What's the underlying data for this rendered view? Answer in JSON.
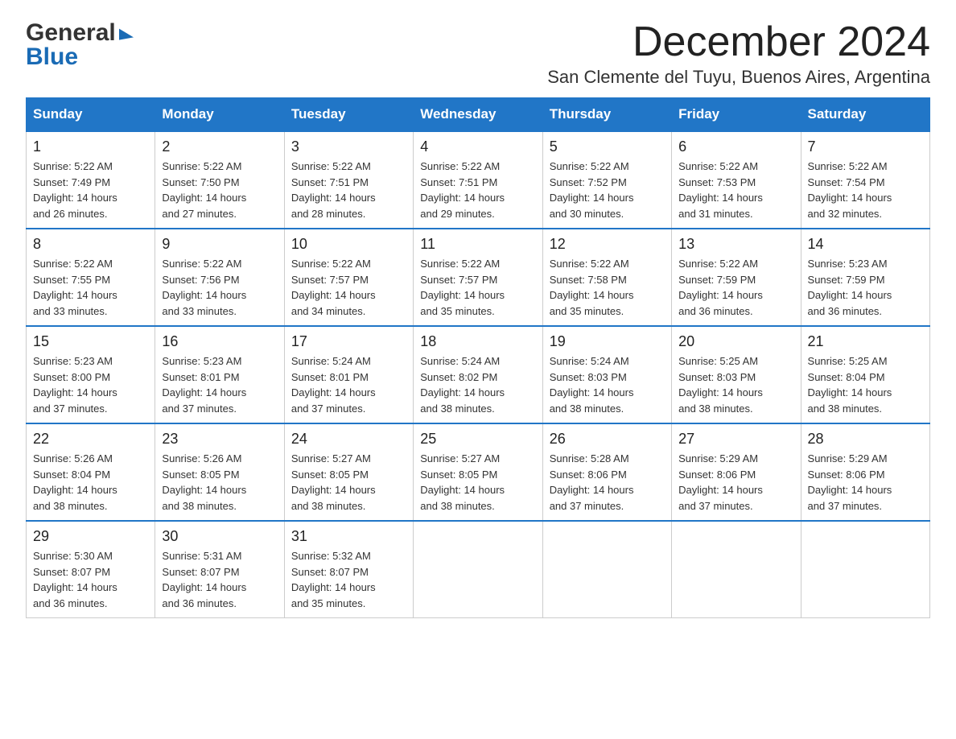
{
  "logo": {
    "line1": "General",
    "line2": "Blue"
  },
  "title": "December 2024",
  "subtitle": "San Clemente del Tuyu, Buenos Aires, Argentina",
  "days_of_week": [
    "Sunday",
    "Monday",
    "Tuesday",
    "Wednesday",
    "Thursday",
    "Friday",
    "Saturday"
  ],
  "weeks": [
    [
      {
        "day": "1",
        "sunrise": "5:22 AM",
        "sunset": "7:49 PM",
        "daylight": "14 hours and 26 minutes."
      },
      {
        "day": "2",
        "sunrise": "5:22 AM",
        "sunset": "7:50 PM",
        "daylight": "14 hours and 27 minutes."
      },
      {
        "day": "3",
        "sunrise": "5:22 AM",
        "sunset": "7:51 PM",
        "daylight": "14 hours and 28 minutes."
      },
      {
        "day": "4",
        "sunrise": "5:22 AM",
        "sunset": "7:51 PM",
        "daylight": "14 hours and 29 minutes."
      },
      {
        "day": "5",
        "sunrise": "5:22 AM",
        "sunset": "7:52 PM",
        "daylight": "14 hours and 30 minutes."
      },
      {
        "day": "6",
        "sunrise": "5:22 AM",
        "sunset": "7:53 PM",
        "daylight": "14 hours and 31 minutes."
      },
      {
        "day": "7",
        "sunrise": "5:22 AM",
        "sunset": "7:54 PM",
        "daylight": "14 hours and 32 minutes."
      }
    ],
    [
      {
        "day": "8",
        "sunrise": "5:22 AM",
        "sunset": "7:55 PM",
        "daylight": "14 hours and 33 minutes."
      },
      {
        "day": "9",
        "sunrise": "5:22 AM",
        "sunset": "7:56 PM",
        "daylight": "14 hours and 33 minutes."
      },
      {
        "day": "10",
        "sunrise": "5:22 AM",
        "sunset": "7:57 PM",
        "daylight": "14 hours and 34 minutes."
      },
      {
        "day": "11",
        "sunrise": "5:22 AM",
        "sunset": "7:57 PM",
        "daylight": "14 hours and 35 minutes."
      },
      {
        "day": "12",
        "sunrise": "5:22 AM",
        "sunset": "7:58 PM",
        "daylight": "14 hours and 35 minutes."
      },
      {
        "day": "13",
        "sunrise": "5:22 AM",
        "sunset": "7:59 PM",
        "daylight": "14 hours and 36 minutes."
      },
      {
        "day": "14",
        "sunrise": "5:23 AM",
        "sunset": "7:59 PM",
        "daylight": "14 hours and 36 minutes."
      }
    ],
    [
      {
        "day": "15",
        "sunrise": "5:23 AM",
        "sunset": "8:00 PM",
        "daylight": "14 hours and 37 minutes."
      },
      {
        "day": "16",
        "sunrise": "5:23 AM",
        "sunset": "8:01 PM",
        "daylight": "14 hours and 37 minutes."
      },
      {
        "day": "17",
        "sunrise": "5:24 AM",
        "sunset": "8:01 PM",
        "daylight": "14 hours and 37 minutes."
      },
      {
        "day": "18",
        "sunrise": "5:24 AM",
        "sunset": "8:02 PM",
        "daylight": "14 hours and 38 minutes."
      },
      {
        "day": "19",
        "sunrise": "5:24 AM",
        "sunset": "8:03 PM",
        "daylight": "14 hours and 38 minutes."
      },
      {
        "day": "20",
        "sunrise": "5:25 AM",
        "sunset": "8:03 PM",
        "daylight": "14 hours and 38 minutes."
      },
      {
        "day": "21",
        "sunrise": "5:25 AM",
        "sunset": "8:04 PM",
        "daylight": "14 hours and 38 minutes."
      }
    ],
    [
      {
        "day": "22",
        "sunrise": "5:26 AM",
        "sunset": "8:04 PM",
        "daylight": "14 hours and 38 minutes."
      },
      {
        "day": "23",
        "sunrise": "5:26 AM",
        "sunset": "8:05 PM",
        "daylight": "14 hours and 38 minutes."
      },
      {
        "day": "24",
        "sunrise": "5:27 AM",
        "sunset": "8:05 PM",
        "daylight": "14 hours and 38 minutes."
      },
      {
        "day": "25",
        "sunrise": "5:27 AM",
        "sunset": "8:05 PM",
        "daylight": "14 hours and 38 minutes."
      },
      {
        "day": "26",
        "sunrise": "5:28 AM",
        "sunset": "8:06 PM",
        "daylight": "14 hours and 37 minutes."
      },
      {
        "day": "27",
        "sunrise": "5:29 AM",
        "sunset": "8:06 PM",
        "daylight": "14 hours and 37 minutes."
      },
      {
        "day": "28",
        "sunrise": "5:29 AM",
        "sunset": "8:06 PM",
        "daylight": "14 hours and 37 minutes."
      }
    ],
    [
      {
        "day": "29",
        "sunrise": "5:30 AM",
        "sunset": "8:07 PM",
        "daylight": "14 hours and 36 minutes."
      },
      {
        "day": "30",
        "sunrise": "5:31 AM",
        "sunset": "8:07 PM",
        "daylight": "14 hours and 36 minutes."
      },
      {
        "day": "31",
        "sunrise": "5:32 AM",
        "sunset": "8:07 PM",
        "daylight": "14 hours and 35 minutes."
      },
      null,
      null,
      null,
      null
    ]
  ],
  "labels": {
    "sunrise": "Sunrise:",
    "sunset": "Sunset:",
    "daylight": "Daylight:"
  }
}
